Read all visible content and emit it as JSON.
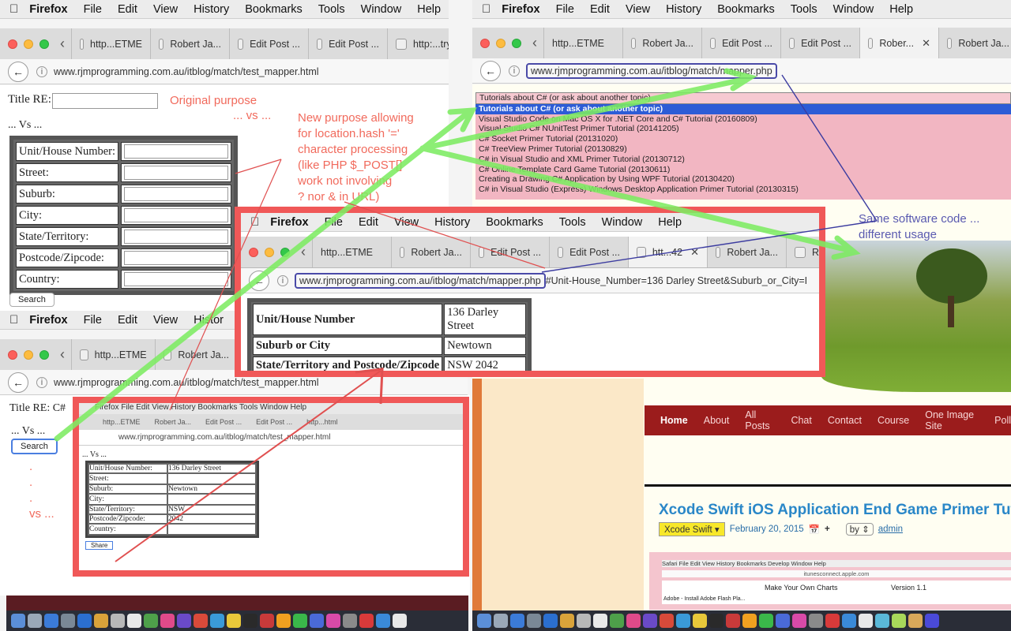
{
  "menubar": {
    "apple": "",
    "app": "Firefox",
    "items": [
      "File",
      "Edit",
      "View",
      "History",
      "Bookmarks",
      "Tools",
      "Window",
      "Help"
    ]
  },
  "left_top": {
    "tabs": [
      "http...ETME",
      "Robert Ja...",
      "Edit Post ...",
      "Edit Post ...",
      "http:...try="
    ],
    "url": "www.rjmprogramming.com.au/itblog/match/test_mapper.html",
    "title_label": "Title RE:",
    "vs": "... Vs ...",
    "fields": [
      "Unit/House Number:",
      "Street:",
      "Suburb:",
      "City:",
      "State/Territory:",
      "Postcode/Zipcode:",
      "Country:"
    ],
    "search": "Search"
  },
  "annotations": {
    "original_purpose": "Original purpose",
    "vs": "... vs ...",
    "new_purpose": [
      "New purpose allowing",
      "for location.hash '='",
      "character processing",
      "(like PHP $_POST[]",
      "work not involving",
      "? nor & in URL)"
    ],
    "same_code": [
      "Same software code ...",
      "different usage"
    ],
    "dots": [
      ".",
      ".",
      "."
    ],
    "vs2": "vs ..."
  },
  "left_bottom": {
    "menu_partial": "Histor",
    "tabs": [
      "http...ETME",
      "Robert Ja..."
    ],
    "url": "www.rjmprogramming.com.au/itblog/match/test_mapper.html",
    "title_label": "Title RE: C#",
    "vs": "... Vs ...",
    "search": "Search"
  },
  "thumb": {
    "menubar": "Firefox  File  Edit  View  History  Bookmarks  Tools  Window  Help",
    "tabs": [
      "http...ETME",
      "Robert Ja...",
      "Edit Post ...",
      "Edit Post ...",
      "http...html"
    ],
    "url": "www.rjmprogramming.com.au/itblog/match/test_mapper.html",
    "vs": "... Vs ...",
    "rows": [
      [
        "Unit/House Number:",
        "136 Darley Street"
      ],
      [
        "Street:",
        ""
      ],
      [
        "Suburb:",
        "Newtown"
      ],
      [
        "City:",
        ""
      ],
      [
        "State/Territory:",
        "NSW"
      ],
      [
        "Postcode/Zipcode:",
        "2042"
      ],
      [
        "Country:",
        ""
      ]
    ],
    "search": "Share"
  },
  "right": {
    "tabs": [
      "http...ETME",
      "Robert Ja...",
      "Edit Post ...",
      "Edit Post ...",
      "Rober...",
      "Robert Ja..."
    ],
    "url": "www.rjmprogramming.com.au/itblog/match/mapper.php",
    "dropdown": [
      "Tutorials about C# (or ask about another topic)",
      "Tutorials about C# (or ask about another topic)",
      "Visual Studio Code on Mac OS X for .NET Core and C# Tutorial (20160809)",
      "Visual Studio C# NUnitTest Primer Tutorial (20141205)",
      "C# Socket Primer Tutorial (20131020)",
      "C# TreeView Primer Tutorial (20130829)",
      "C# in Visual Studio and XML Primer Tutorial (20130712)",
      "C# Online Template Card Game Tutorial (20130611)",
      "Creating a Drawing C# Application by Using WPF Tutorial (20130420)",
      "C# in Visual Studio (Express) Windows Desktop Application Primer Tutorial (20130315)"
    ],
    "nav": [
      "Home",
      "About",
      "All Posts",
      "Chat",
      "Contact",
      "Course",
      "One Image Site",
      "Poll"
    ],
    "post_title": "Xcode Swift iOS Application End Game Primer Tut",
    "category": "Xcode Swift",
    "date": "February 20, 2015",
    "by": "by",
    "author": "admin",
    "safari_menu": "Safari  File  Edit  View  History  Bookmarks  Develop  Window  Help",
    "safari_url": "itunesconnect.apple.com",
    "charts_text": "Make Your Own Charts",
    "version": "Version 1.1",
    "flash_text": "Adobe - Install Adobe Flash Pla..."
  },
  "middle": {
    "tabs": [
      "http...ETME",
      "Robert Ja...",
      "Edit Post ...",
      "Edit Post ...",
      "htt...42",
      "Robert Ja...",
      "Robert"
    ],
    "url_base": "www.rjmprogramming.com.au/itblog/match/mapper.php",
    "url_hash": "#Unit-House_Number=136 Darley Street&Suburb_or_City=I",
    "rows": [
      [
        "Unit/House Number",
        "136 Darley Street"
      ],
      [
        "Suburb or City",
        "Newtown"
      ],
      [
        "State/Territory and Postcode/Zipcode",
        "NSW 2042"
      ]
    ]
  },
  "colors": {
    "annot_red": "#f16a5c",
    "arrow_green": "#7dec62",
    "frame_red": "#f05858",
    "annot_blue": "#5a5ab0",
    "nav_red": "#9b1c1c"
  }
}
